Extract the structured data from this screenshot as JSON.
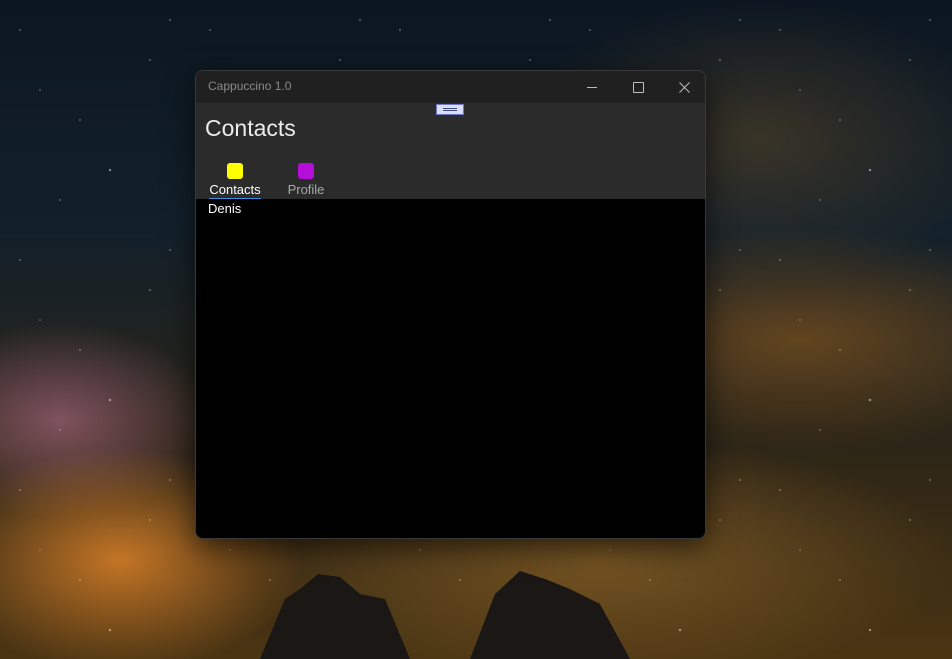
{
  "window": {
    "title": "Cappuccino 1.0",
    "controls": [
      "minimize-icon",
      "maximize-icon",
      "close-icon"
    ]
  },
  "page": {
    "title": "Contacts"
  },
  "tabs": [
    {
      "label": "Contacts",
      "icon": "yellow-square-icon",
      "color": "#ffff00",
      "selected": true
    },
    {
      "label": "Profile",
      "icon": "purple-square-icon",
      "color": "#b40ed8",
      "selected": false
    }
  ],
  "contacts": [
    {
      "name": "Denis"
    }
  ],
  "colors": {
    "tab_selected_underline": "#3d8ee0",
    "header_bg": "#2b2b2b",
    "content_bg": "#000000"
  }
}
